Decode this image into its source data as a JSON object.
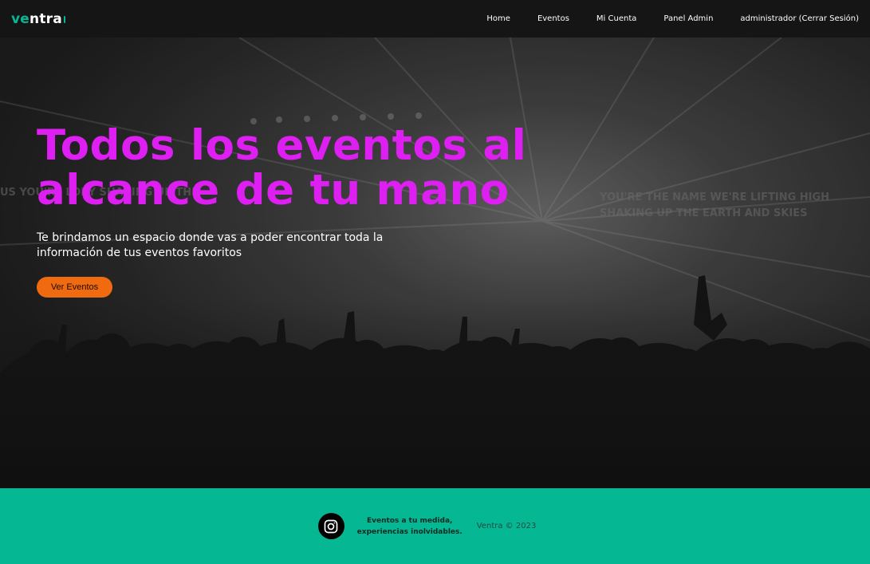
{
  "navbar": {
    "brand_main": "ve",
    "brand_rest": "ntra",
    "links": [
      {
        "label": "Home"
      },
      {
        "label": "Eventos"
      },
      {
        "label": "Mi Cuenta"
      },
      {
        "label": "Panel Admin"
      },
      {
        "label": "administrador (Cerrar Sesión)"
      }
    ]
  },
  "hero": {
    "title_line1": "Todos los eventos al",
    "title_line2": "alcance de tu mano",
    "subtitle": "Te brindamos un espacio donde vas a poder encontrar toda la información de tus eventos favoritos",
    "button_label": "Ver Eventos",
    "background_text_left": "US YOU'RE LORY SHAKING UP THE",
    "background_text_right_1": "YOU'RE THE NAME WE'RE LIFTING HIGH",
    "background_text_right_2": "SHAKING UP THE EARTH AND SKIES"
  },
  "footer": {
    "social_icon": "instagram-icon",
    "tagline_line1": "Eventos a tu medida,",
    "tagline_line2": "experiencias inolvidables.",
    "copyright": "Ventra © 2023"
  },
  "colors": {
    "navbar_bg": "#151515",
    "brand_accent": "#06b794",
    "hero_title": "#dd1ff2",
    "button_bg": "#f06a10",
    "footer_bg": "#06b794"
  }
}
